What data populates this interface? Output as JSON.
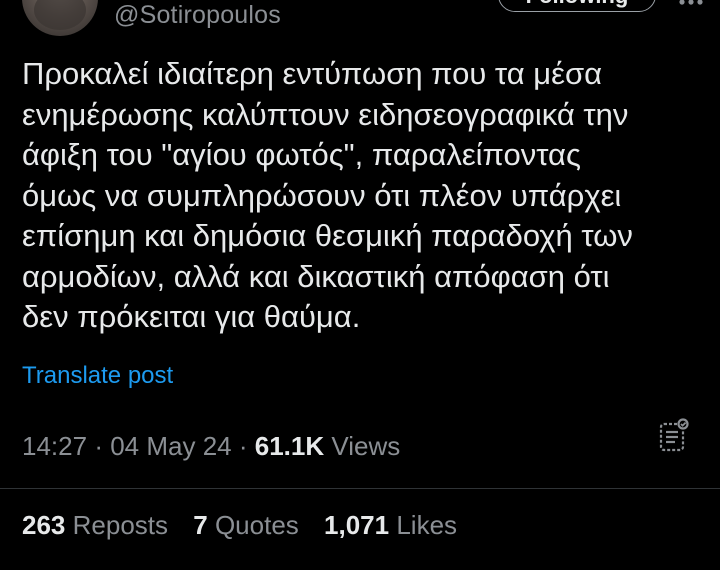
{
  "header": {
    "handle": "@Sotiropoulos",
    "follow_label": "Following"
  },
  "tweet": {
    "text": "Προκαλεί ιδιαίτερη εντύπωση που τα μέσα\nενημέρωσης καλύπτουν ειδησεογραφικά την\nάφιξη του \"αγίου φωτός\", παραλείποντας\nόμως να συμπληρώσουν ότι πλέον υπάρχει\nεπίσημη και δημόσια θεσμική παραδοχή των\nαρμοδίων, αλλά και δικαστική απόφαση ότι\nδεν πρόκειται για θαύμα.",
    "translate_label": "Translate post"
  },
  "meta": {
    "time": "14:27",
    "separator": "·",
    "date": "04 May 24",
    "views_count": "61.1K",
    "views_label": "Views"
  },
  "stats": {
    "reposts_count": "263",
    "reposts_label": "Reposts",
    "quotes_count": "7",
    "quotes_label": "Quotes",
    "likes_count": "1,071",
    "likes_label": "Likes"
  },
  "icons": {
    "more": "more-icon",
    "analytics": "analytics-icon"
  },
  "colors": {
    "background": "#000000",
    "text": "#e7e9ea",
    "muted": "#8b8f94",
    "link": "#1d9bf0"
  }
}
